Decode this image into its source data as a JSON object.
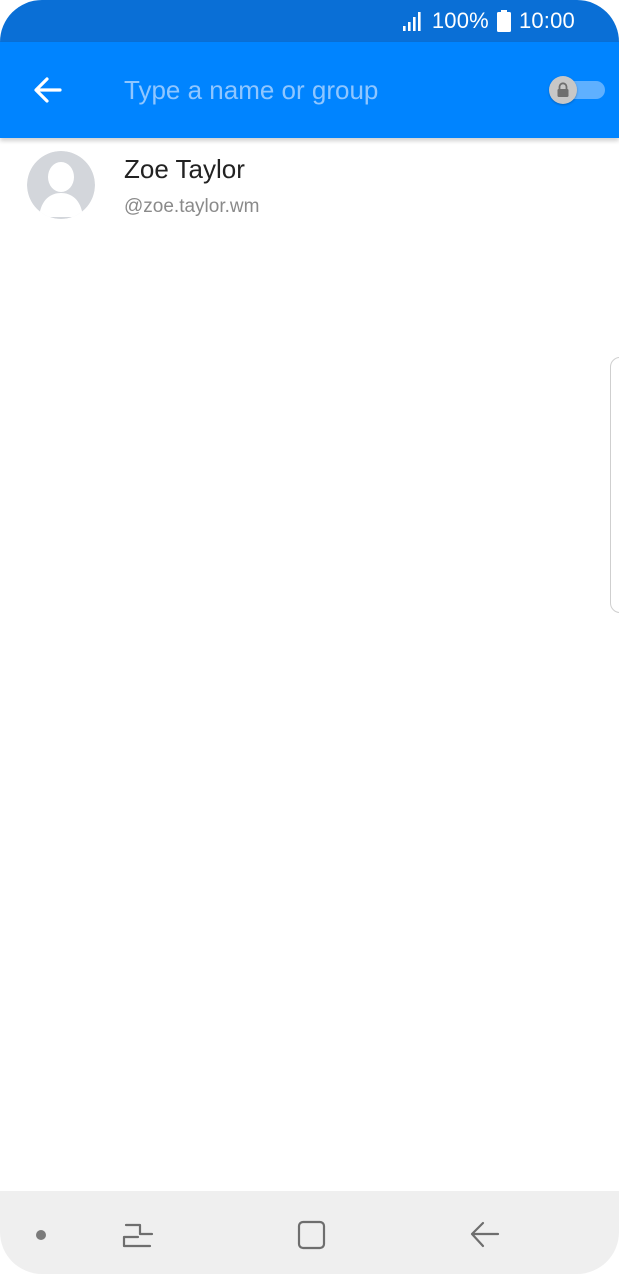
{
  "status_bar": {
    "battery_percent": "100%",
    "time": "10:00",
    "signal_icon": "signal-icon",
    "battery_icon": "battery-icon"
  },
  "app_bar": {
    "back_icon": "arrow-left-icon",
    "search": {
      "value": "",
      "placeholder": "Type a name or group"
    },
    "secret_toggle": {
      "icon": "lock-icon",
      "on": false
    }
  },
  "contacts": [
    {
      "name": "Zoe Taylor",
      "handle": "@zoe.taylor.wm",
      "avatar_icon": "default-avatar-icon"
    }
  ],
  "nav_bar": {
    "items": [
      "dot-icon",
      "recents-icon",
      "home-icon",
      "back-icon"
    ]
  },
  "colors": {
    "status_bar": "#0a6fd6",
    "app_bar": "#0084ff",
    "placeholder": "#8fc6ff",
    "nav_bar": "#efefef"
  }
}
